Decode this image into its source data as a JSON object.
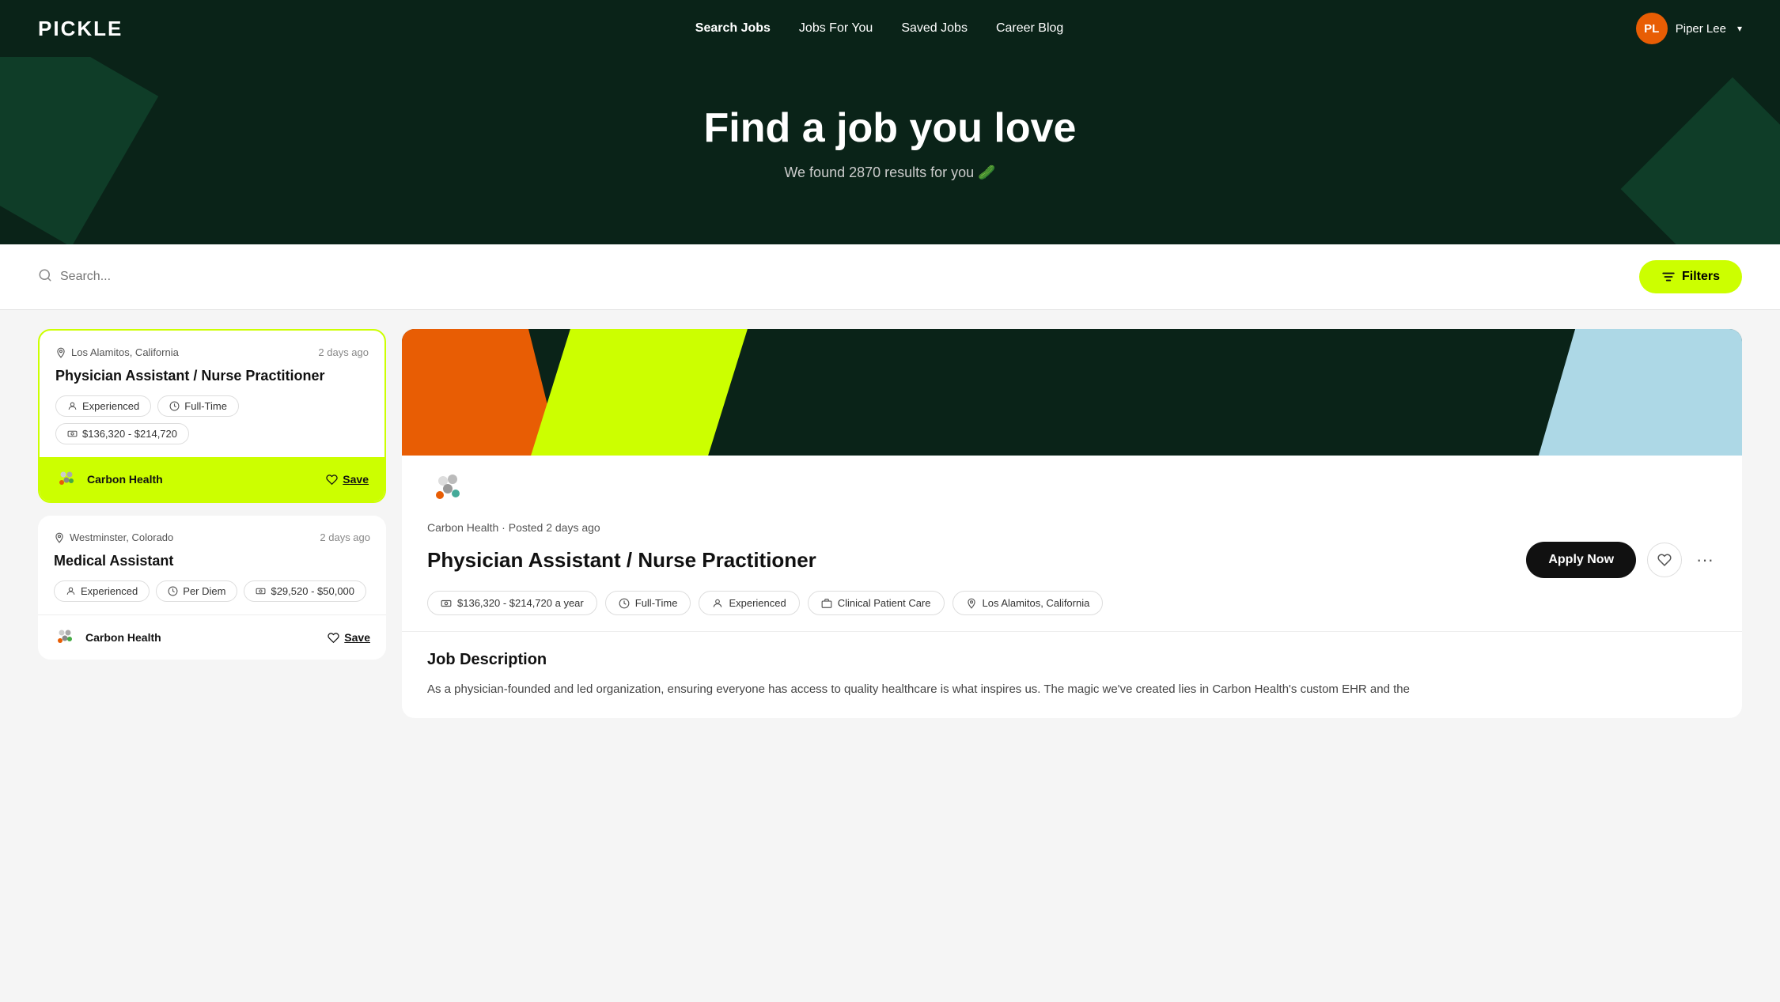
{
  "navbar": {
    "logo": "PICKLE",
    "nav_items": [
      {
        "label": "Search Jobs",
        "active": true
      },
      {
        "label": "Jobs For You",
        "active": false
      },
      {
        "label": "Saved Jobs",
        "active": false
      },
      {
        "label": "Career Blog",
        "active": false
      }
    ],
    "user": {
      "initials": "PL",
      "name": "Piper Lee"
    }
  },
  "hero": {
    "title": "Find a job you love",
    "subtitle": "We found 2870 results for you 🥒"
  },
  "search": {
    "placeholder": "Search...",
    "filters_label": "Filters"
  },
  "jobs": [
    {
      "location": "Los Alamitos, California",
      "time_ago": "2 days ago",
      "title": "Physician Assistant / Nurse Practitioner",
      "tags": [
        {
          "icon": "person-icon",
          "label": "Experienced"
        },
        {
          "icon": "clock-icon",
          "label": "Full-Time"
        },
        {
          "icon": "salary-icon",
          "label": "$136,320 - $214,720"
        }
      ],
      "company": "Carbon Health",
      "selected": true
    },
    {
      "location": "Westminster, Colorado",
      "time_ago": "2 days ago",
      "title": "Medical Assistant",
      "tags": [
        {
          "icon": "person-icon",
          "label": "Experienced"
        },
        {
          "icon": "clock-icon",
          "label": "Per Diem"
        },
        {
          "icon": "salary-icon",
          "label": "$29,520 - $50,000"
        }
      ],
      "company": "Carbon Health",
      "selected": false
    }
  ],
  "job_detail": {
    "company": "Carbon Health",
    "posted": "Posted 2 days ago",
    "title": "Physician Assistant / Nurse Practitioner",
    "apply_label": "Apply Now",
    "tags": [
      {
        "icon": "salary-icon",
        "label": "$136,320 - $214,720 a year"
      },
      {
        "icon": "clock-icon",
        "label": "Full-Time"
      },
      {
        "icon": "person-icon",
        "label": "Experienced"
      },
      {
        "icon": "briefcase-icon",
        "label": "Clinical Patient Care"
      },
      {
        "icon": "location-icon",
        "label": "Los Alamitos, California"
      }
    ],
    "description_title": "Job Description",
    "description_text": "As a physician-founded and led organization, ensuring everyone has access to quality healthcare is what inspires us. The magic we've created lies in Carbon Health's custom EHR and the"
  }
}
